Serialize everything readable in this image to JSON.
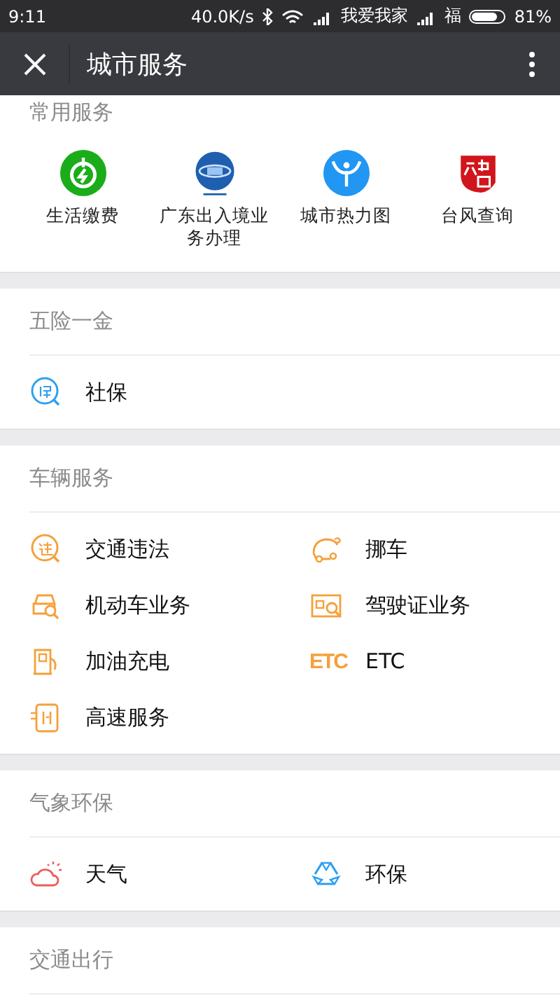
{
  "status_bar": {
    "time": "9:11",
    "speed": "40.0K/s",
    "carrier_1": "我爱我家",
    "carrier_2": "福",
    "battery": "81%"
  },
  "nav_bar": {
    "title": "城市服务"
  },
  "sections": [
    {
      "kind": "grid",
      "title": "常用服务",
      "items": [
        {
          "label": "生活缴费",
          "kind": "bolt"
        },
        {
          "label": "广东出入境业务办理",
          "kind": "globe"
        },
        {
          "label": "城市热力图",
          "kind": "person"
        },
        {
          "label": "台风查询",
          "kind": "seal"
        }
      ]
    },
    {
      "kind": "list",
      "title": "五险一金",
      "items": [
        {
          "label": "社保",
          "kind": "insurance"
        }
      ]
    },
    {
      "kind": "list",
      "title": "车辆服务",
      "items": [
        {
          "label": "交通违法",
          "kind": "violation"
        },
        {
          "label": "挪车",
          "kind": "car"
        },
        {
          "label": "机动车业务",
          "kind": "vehicle"
        },
        {
          "label": "驾驶证业务",
          "kind": "license"
        },
        {
          "label": "加油充电",
          "kind": "fuel"
        },
        {
          "label": "ETC",
          "kind": "text",
          "icon_text": "ETC"
        },
        {
          "label": "高速服务",
          "kind": "highway"
        }
      ]
    },
    {
      "kind": "list",
      "title": "气象环保",
      "items": [
        {
          "label": "天气",
          "kind": "weather"
        },
        {
          "label": "环保",
          "kind": "recycle"
        }
      ]
    },
    {
      "kind": "list",
      "title": "交通出行"
    }
  ]
}
